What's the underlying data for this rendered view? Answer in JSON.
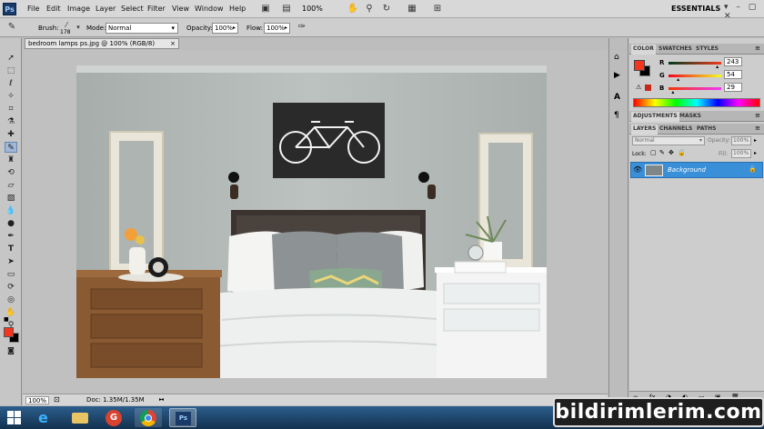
{
  "app": {
    "logo": "Ps"
  },
  "menu": [
    "File",
    "Edit",
    "Image",
    "Layer",
    "Select",
    "Filter",
    "View",
    "Window",
    "Help"
  ],
  "toolbar": {
    "zoom": "100%",
    "workspace": "ESSENTIALS"
  },
  "options": {
    "brush_label": "Brush:",
    "brush_size": "178",
    "mode_label": "Mode:",
    "mode_value": "Normal",
    "opacity_label": "Opacity:",
    "opacity_value": "100%",
    "flow_label": "Flow:",
    "flow_value": "100%"
  },
  "document": {
    "tab_title": "bedroom lamps ps.jpg @ 100% (RGB/8)",
    "tab_close": "×"
  },
  "status": {
    "zoom": "100%",
    "doc": "Doc: 1.35M/1.35M"
  },
  "color_panel": {
    "tabs": [
      "COLOR",
      "SWATCHES",
      "STYLES"
    ],
    "channels": [
      {
        "name": "R",
        "value": "243",
        "fraction": 0.95
      },
      {
        "name": "G",
        "value": "54",
        "fraction": 0.21
      },
      {
        "name": "B",
        "value": "29",
        "fraction": 0.11
      }
    ],
    "foreground": "#f3361d",
    "background": "#000000"
  },
  "adjust_panel": {
    "tabs": [
      "ADJUSTMENTS",
      "MASKS"
    ]
  },
  "layers_panel": {
    "tabs": [
      "LAYERS",
      "CHANNELS",
      "PATHS"
    ],
    "blend_mode": "Normal",
    "opacity_label": "Opacity:",
    "opacity_value": "100%",
    "lock_label": "Lock:",
    "fill_label": "Fill:",
    "fill_value": "100%",
    "layer_name": "Background"
  },
  "watermark": "bildirimlerim.com",
  "colors": {
    "accent": "#3a8fd9",
    "ps_blue": "#1a3b6a"
  }
}
